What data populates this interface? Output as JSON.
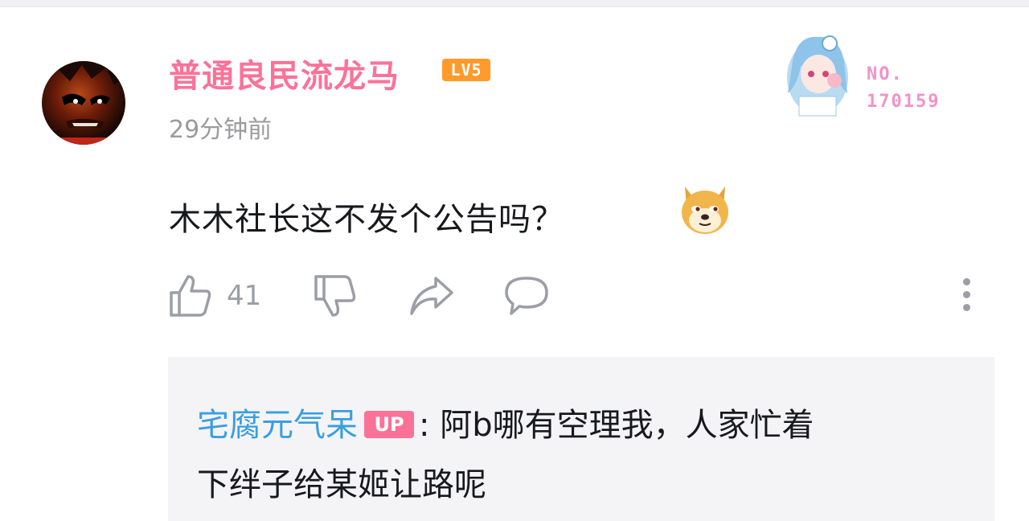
{
  "comment": {
    "username": "普通良民流龙马",
    "level": "LV5",
    "time": "29分钟前",
    "fan_badge": {
      "line1": "NO.",
      "line2": "170159"
    },
    "text": "木木社长这不发个公告吗？",
    "likes": "41"
  },
  "reply": {
    "author": "宅腐元气呆",
    "author_badge": "UP",
    "separator": ":",
    "text_line1": "阿b哪有空理我，人家忙着",
    "text_line2": "下绊子给某姬让路呢"
  },
  "colors": {
    "username": "#fb7299",
    "reply_author": "#3a9ee0",
    "level_badge": "#ff9a2b",
    "up_badge": "#fb7299"
  }
}
